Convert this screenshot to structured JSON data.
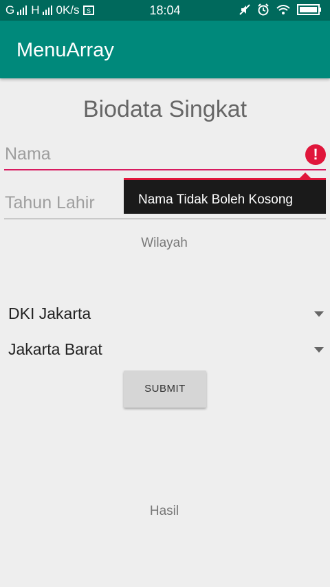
{
  "status_bar": {
    "carrier_1": "G",
    "carrier_2": "H",
    "speed": "0K/s",
    "time": "18:04",
    "icons": [
      "signal-icon",
      "screenshot-icon",
      "mute-icon",
      "alarm-icon",
      "wifi-icon",
      "battery-icon"
    ]
  },
  "app_bar": {
    "title": "MenuArray"
  },
  "form": {
    "title": "Biodata Singkat",
    "nama_placeholder": "Nama",
    "tahun_placeholder": "Tahun Lahir",
    "error_message": "Nama Tidak Boleh Kosong",
    "wilayah_label": "Wilayah",
    "provinsi_selected": "DKI Jakarta",
    "kota_selected": "Jakarta Barat",
    "submit_label": "SUBMIT",
    "hasil_label": "Hasil"
  },
  "colors": {
    "status_bar": "#00695c",
    "app_bar": "#00897b",
    "error": "#e0163b",
    "accent_underline": "#d81b60"
  }
}
